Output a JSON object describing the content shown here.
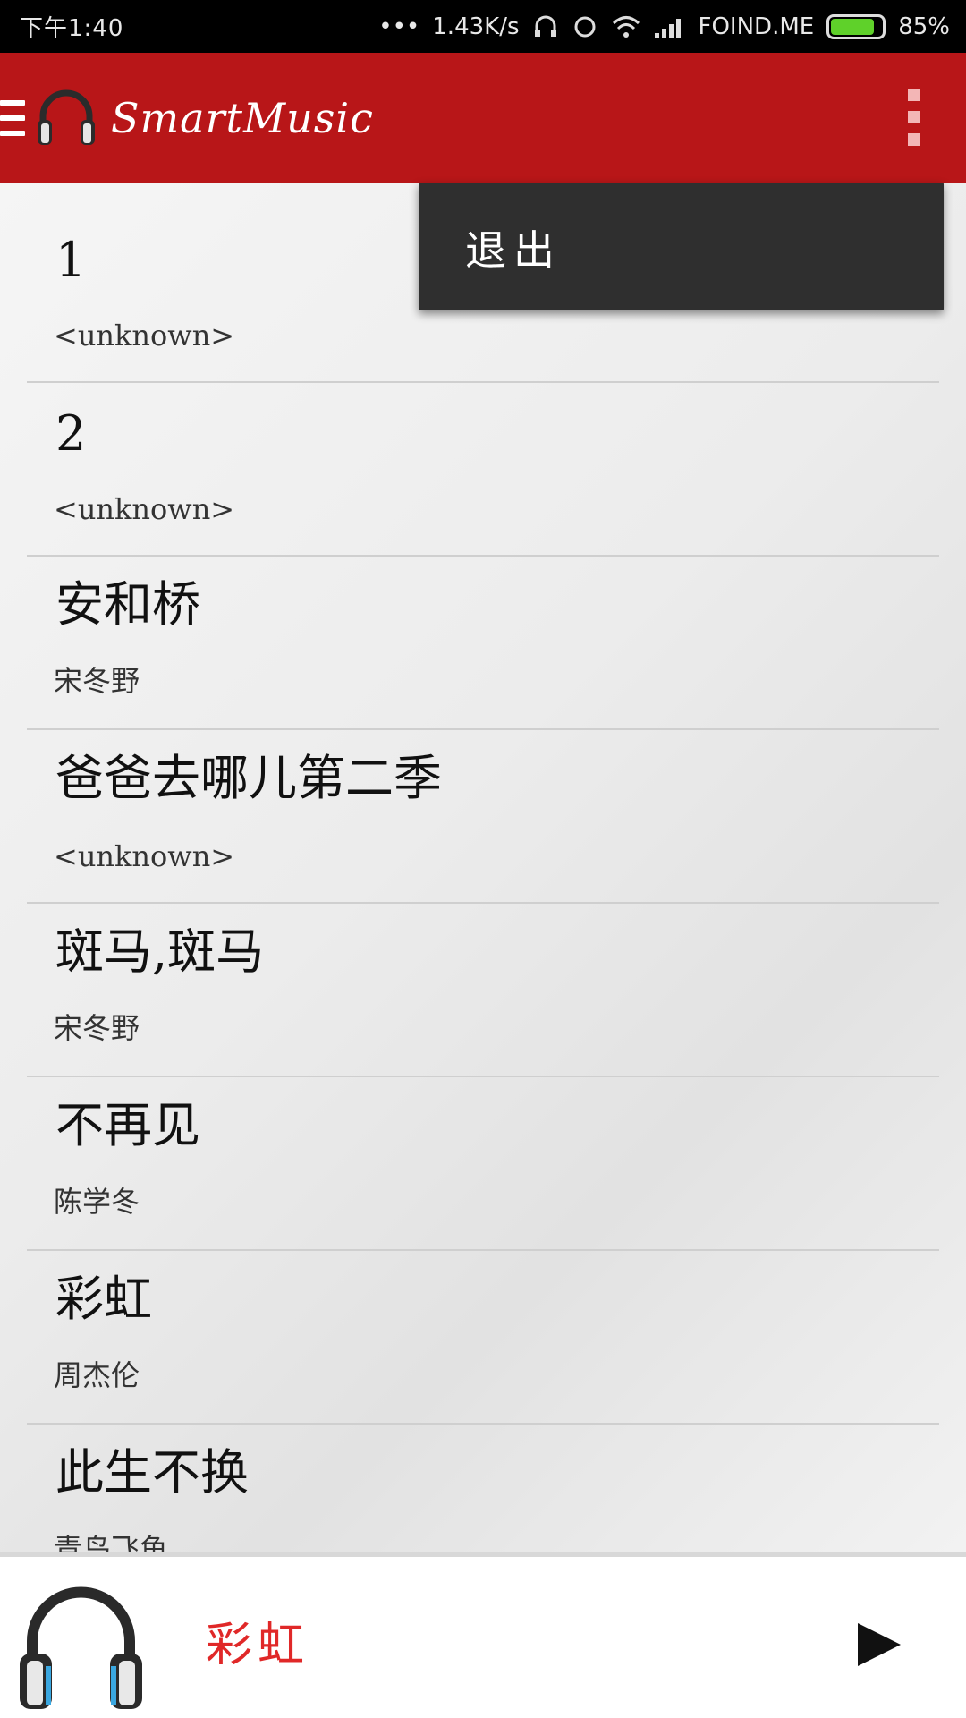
{
  "status_bar": {
    "time": "下午1:40",
    "net_speed": "1.43K/s",
    "carrier": "FOIND.ME",
    "battery": "85%",
    "battery_level": 0.85
  },
  "app_bar": {
    "title": "SmartMusic",
    "icons": [
      "menu-icon",
      "headphones-logo-icon",
      "overflow-menu-icon"
    ]
  },
  "overflow_menu": {
    "items": [
      {
        "label": "退出"
      }
    ]
  },
  "songs": [
    {
      "title": "1",
      "artist": "<unknown>"
    },
    {
      "title": "2",
      "artist": "<unknown>"
    },
    {
      "title": "安和桥",
      "artist": "宋冬野"
    },
    {
      "title": "爸爸去哪儿第二季",
      "artist": "<unknown>"
    },
    {
      "title": "斑马,斑马",
      "artist": "宋冬野"
    },
    {
      "title": "不再见",
      "artist": "陈学冬"
    },
    {
      "title": "彩虹",
      "artist": "周杰伦"
    },
    {
      "title": "此生不换",
      "artist": "青鸟飞鱼"
    }
  ],
  "player": {
    "now_playing": "彩虹",
    "icons": [
      "headphones-art-icon",
      "play-icon"
    ]
  },
  "colors": {
    "app_bar": "#b81618",
    "now_playing_text": "#e02828",
    "menu_bg": "#2f2f2f"
  }
}
